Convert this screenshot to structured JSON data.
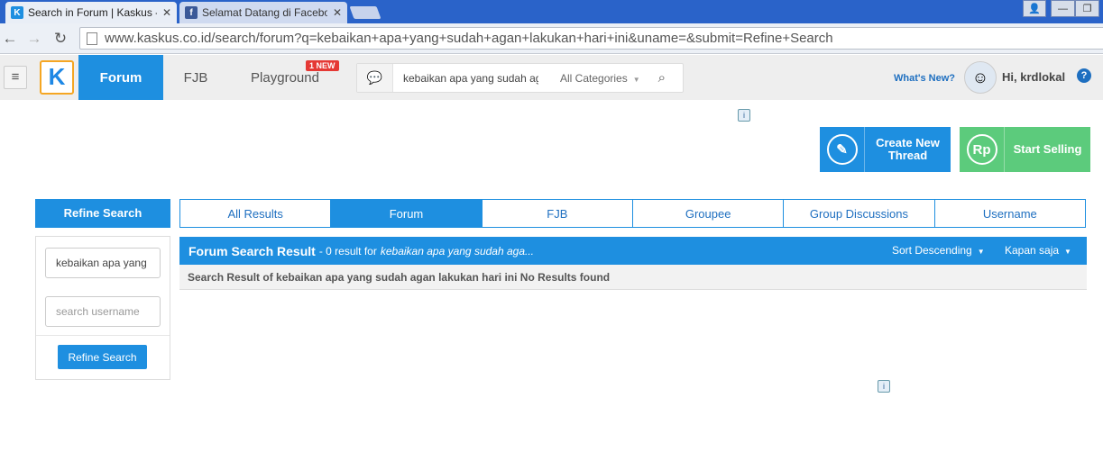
{
  "browser": {
    "tabs": [
      {
        "title": "Search in Forum | Kaskus -",
        "favicon": "kaskus-favicon",
        "active": true
      },
      {
        "title": "Selamat Datang di Facebo",
        "favicon": "facebook-favicon",
        "active": false
      }
    ],
    "address": "www.kaskus.co.id/search/forum?q=kebaikan+apa+yang+sudah+agan+lakukan+hari+ini&uname=&submit=Refine+Search",
    "window_controls": [
      "minimize",
      "maximize",
      "close"
    ]
  },
  "header": {
    "logo_text": "K",
    "nav": [
      {
        "label": "Forum",
        "active": true
      },
      {
        "label": "FJB",
        "active": false
      },
      {
        "label": "Playground",
        "active": false
      }
    ],
    "new_badge": "1 NEW",
    "search_value": "kebaikan apa yang sudah agan lakukan hari ini",
    "category_label": "All Categories",
    "whats_new": "What's New?",
    "greeting": "Hi, krdlokal",
    "help_label": "?"
  },
  "actions": {
    "create_thread": "Create New Thread",
    "start_selling": "Start Selling",
    "selling_icon_text": "Rp"
  },
  "refine": {
    "heading": "Refine Search",
    "keyword_value": "kebaikan apa yang sudah agan lakukan hari ini",
    "username_placeholder": "search username",
    "button_label": "Refine Search"
  },
  "result_tabs": [
    {
      "label": "All Results",
      "active": false
    },
    {
      "label": "Forum",
      "active": true
    },
    {
      "label": "FJB",
      "active": false
    },
    {
      "label": "Groupee",
      "active": false
    },
    {
      "label": "Group Discussions",
      "active": false
    },
    {
      "label": "Username",
      "active": false
    }
  ],
  "results": {
    "title": "Forum Search Result",
    "count_text": "- 0 result for",
    "query_text": "kebaikan apa yang sudah aga...",
    "sort_label": "Sort Descending",
    "time_label": "Kapan saja",
    "message": "Search Result of kebaikan apa yang sudah agan lakukan hari ini No Results found"
  },
  "colors": {
    "accent": "#1e8fe0",
    "selling_green": "#5ccb7c",
    "logo_border": "#f5a623"
  }
}
